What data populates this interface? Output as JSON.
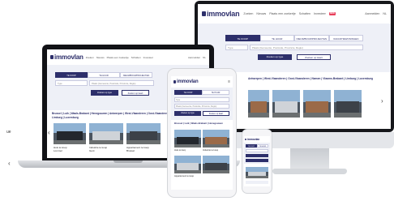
{
  "brand": {
    "name": "immovlan",
    "accent": "#2d2f6b",
    "highlight": "#e83e5a"
  },
  "nav": {
    "items": [
      "Zoeken",
      "Nieuws",
      "Plaats een zoekertje",
      "Schatten",
      "Investeer"
    ],
    "badge": "NEW",
    "account": "Aanmelden",
    "language": "NL"
  },
  "search": {
    "tabs": [
      "TE KOOP",
      "TE HUUR",
      "NIEUWBOUWPROJECTEN",
      "VAKANTIEWONINGEN"
    ],
    "type_placeholder": "Type",
    "location_placeholder": "Plaats (Gemeente, Postcode, Provincie, Regio)",
    "search_button": "Zoeken op type",
    "map_button": "Zoeken op kaart"
  },
  "cities": [
    "Brussel",
    "Luik",
    "Waals-Brabant",
    "Henegouwen",
    "Antwerpen",
    "West-Vlaanderen",
    "Oost-Vlaanderen",
    "Namen",
    "Vlaams-Brabant",
    "Limburg",
    "Luxemburg"
  ],
  "listings": [
    {
      "title": "Huis te koop",
      "place": "Lommel"
    },
    {
      "title": "Industrie te koop",
      "place": "Gent"
    },
    {
      "title": "Appartement te koop",
      "place": "Brussel"
    }
  ],
  "side_text": "ue",
  "icons": [
    "menu-icon",
    "chevron-left-icon",
    "chevron-right-icon",
    "search-icon"
  ]
}
